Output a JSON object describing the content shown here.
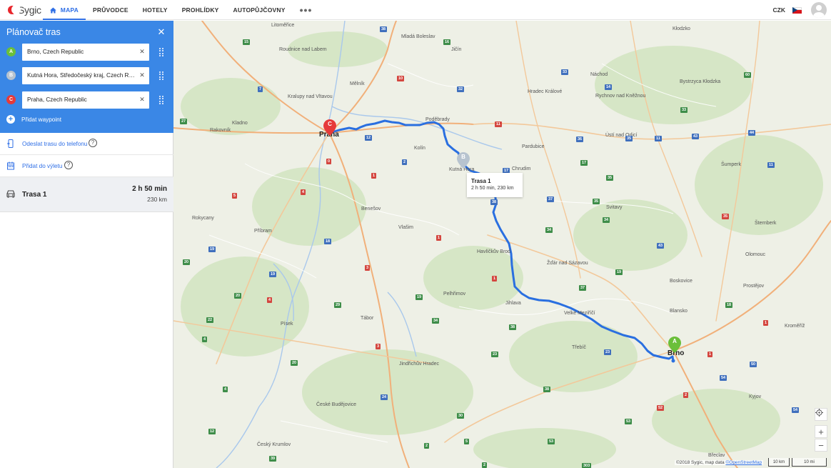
{
  "brand": {
    "name": "Sygic"
  },
  "nav": {
    "items": [
      "MAPA",
      "PRŮVODCE",
      "HOTELY",
      "PROHLÍDKY",
      "AUTOPŮJČOVNY"
    ],
    "more": "•••"
  },
  "top_right": {
    "currency": "CZK"
  },
  "planner": {
    "title": "Plánovač tras",
    "waypoints": [
      {
        "marker": "A",
        "value": "Brno, Czech Republic"
      },
      {
        "marker": "B",
        "value": "Kutná Hora, Středočeský kraj, Czech Republic"
      },
      {
        "marker": "C",
        "value": "Praha, Czech Republic"
      }
    ],
    "add_waypoint": "Přidat waypoint"
  },
  "actions": {
    "send_to_phone": "Odeslat trasu do telefonu",
    "add_to_trip": "Přidat do výletu",
    "help": "?"
  },
  "routes": [
    {
      "name": "Trasa 1",
      "time": "2 h 50 min",
      "distance": "230 km"
    }
  ],
  "map": {
    "tooltip": {
      "title": "Trasa 1",
      "subtitle": "2 h 50 min, 230 km"
    },
    "pins": {
      "a": "A",
      "b": "B",
      "c": "C"
    },
    "cities": [
      "Litoměřice",
      "Roudnice nad Labem",
      "Kralupy nad Vltavou",
      "Kladno",
      "Rakovník",
      "Praha",
      "Mělník",
      "Poděbrady",
      "Kutná Hora",
      "Kolín",
      "Benešov",
      "Rokycany",
      "Příbram",
      "Vlašim",
      "Tábor",
      "Písek",
      "Pelhřimov",
      "Jihlava",
      "Havlíčkův Brod",
      "Třebíč",
      "Velké Meziříčí",
      "Brno",
      "Blansko",
      "Boskovice",
      "Prostějov",
      "Olomouc",
      "Kroměříž",
      "Kyjov",
      "Břeclav",
      "Český Krumlov",
      "České Budějovice",
      "Jindřichův Hradec",
      "Hradec Králové",
      "Pardubice",
      "Chrudim",
      "Svitavy",
      "Šumperk",
      "Šternberk",
      "Ústí nad Orlicí",
      "Rychnov nad Kněžnou",
      "Náchod",
      "Jičín",
      "Mladá Boleslav",
      "Kłodzko",
      "Bystrzyca Kłodzka",
      "Žďár nad Sázavou",
      "Strakonice",
      "Vodňany",
      "Moravský Krumlov",
      "Znojmo",
      "Vyškov",
      "Hodonín",
      "Uherské Hradiště",
      "Zlín",
      "Dvůr Králové nad Labem",
      "Trutnov",
      "Jaroměř",
      "Litomyšl",
      "Polička",
      "Telč",
      "Dačice",
      "Třeboň",
      "Milevsko",
      "Sedlčany",
      "Hořovice",
      "Beroun",
      "Slaný",
      "Louny",
      "Nymburk",
      "Čáslav",
      "Chotěboř",
      "Humpolec",
      "Ledeč nad Sázavou",
      "Jindřichův",
      "Kaplice",
      "Vimperk",
      "Prachatice",
      "Lanškroun",
      "Mohelnice",
      "Zábřeh",
      "Jeseník",
      "Nové Město nad Metují",
      "Dobruška",
      "Rumburk",
      "Hořice",
      "Nová Paka",
      "Semily",
      "Turnov",
      "Mnichovo Hradiště",
      "Nový Bydžov",
      "Chlumec nad Cidlinou",
      "Přelouč",
      "Heřmanův Městec",
      "Hlinsko",
      "Skuteč",
      "Vysoké Mýto",
      "Choceň",
      "Česká Třebová",
      "Moravská Třebová",
      "Letovice",
      "Kunštát",
      "Bystřice nad Pernštejnem",
      "Nové Město na Moravě",
      "Tišnov",
      "Rosice",
      "Ivančice",
      "Náměšť nad Oslavou",
      "Moravské Budějovice",
      "Hrotovice",
      "Jemnice",
      "Slavonice",
      "Nová Bystřice",
      "Kamenice nad Lipou",
      "Pacov",
      "Počátky",
      "Černovice",
      "Mladá Vožice",
      "Soběslav",
      "Veselí nad Lužnicí",
      "Lišov",
      "Hluboká nad Vltavou",
      "Týn nad Vltavou",
      "Protivín",
      "Blatná",
      "Březnice",
      "Rožmitál pod Třemšínem",
      "Nepomuk",
      "Horažďovice",
      "Sušice",
      "Volary",
      "Kremže",
      "Wörgl"
    ],
    "visible_cities": [
      "Litoměřice",
      "Roudnice nad Labem",
      "Kralupy nad Vltavou",
      "Kladno",
      "Rakovník",
      "Praha",
      "Mělník",
      "Poděbrady",
      "Kutná Hora",
      "Kolín",
      "Benešov",
      "Rokycany",
      "Příbram",
      "Vlašim",
      "Tábor",
      "Písek",
      "Pelhřimov",
      "Jihlava",
      "Havlíčkův Brod",
      "Třebíč",
      "Velké Meziříčí",
      "Brno",
      "Blansko",
      "Boskovice",
      "Prostějov",
      "Olomouc",
      "Kroměříž",
      "Kyjov",
      "Břeclav",
      "Český Krumlov",
      "České Budějovice",
      "Jindřichův Hradec",
      "Hradec Králové",
      "Pardubice",
      "Chrudim",
      "Svitavy",
      "Šumperk",
      "Šternberk",
      "Ústí nad Orlicí",
      "Rychnov nad Kněžnou",
      "Náchod",
      "Jičín",
      "Mladá Boleslav",
      "Kłodzko",
      "Bystrzyca Kłodzka",
      "Žďár nad Sázavou",
      "Strakonice",
      "Moravský Krumlov",
      "Znojmo",
      "Vyškov",
      "Hodonín",
      "Uherské Hradiště",
      "Zlín",
      "Dvůr Králové nad Labem",
      "Trutnov",
      "Litomyšl",
      "Polička",
      "Telč",
      "Dačice",
      "Třeboň",
      "Milevsko",
      "Sedlčany",
      "Hořovice",
      "Beroun",
      "Slaný",
      "Louny",
      "Nymburk",
      "Čáslav",
      "Chotěboř",
      "Humpolec",
      "Ledeč nad Sázavou",
      "Kaplice",
      "Vimperk",
      "Prachatice",
      "Lanškroun",
      "Mohelnice",
      "Zábřeh",
      "Jeseník",
      "Náchod",
      "Dobruška",
      "Hořice",
      "Semily",
      "Turnov",
      "Nový Bydžov",
      "Přelouč",
      "Hlinsko",
      "Vysoké Mýto",
      "Choceň",
      "Česká Třebová",
      "Moravská Třebová",
      "Letovice",
      "Bystřice nad Pernštejnem",
      "Nové Město na Moravě",
      "Tišnov",
      "Ivančice",
      "Náměšť nad Oslavou",
      "Moravské Budějovice",
      "Slavonice",
      "Kamenice nad Lipou",
      "Pacov",
      "Soběslav",
      "Veselí nad Lužnicí",
      "Týn nad Vltavou",
      "Blatná",
      "Březnice",
      "Nepomuk",
      "Horažďovice",
      "Sušice",
      "Volary",
      "Waldkirchen"
    ],
    "attribution": {
      "text": "©2018 Sygic, map data ",
      "link": "©OpenStreetMap"
    },
    "scale": {
      "km": "10 km",
      "mi": "10 mi"
    },
    "controls": {
      "locate": "⌖",
      "zoom_in": "+",
      "zoom_out": "−"
    }
  },
  "colors": {
    "accent": "#3a87e6",
    "route": "#2a6fe0",
    "pin_a": "#6bbf3a",
    "pin_b": "#b7c3cf",
    "pin_c": "#e63a3a"
  }
}
